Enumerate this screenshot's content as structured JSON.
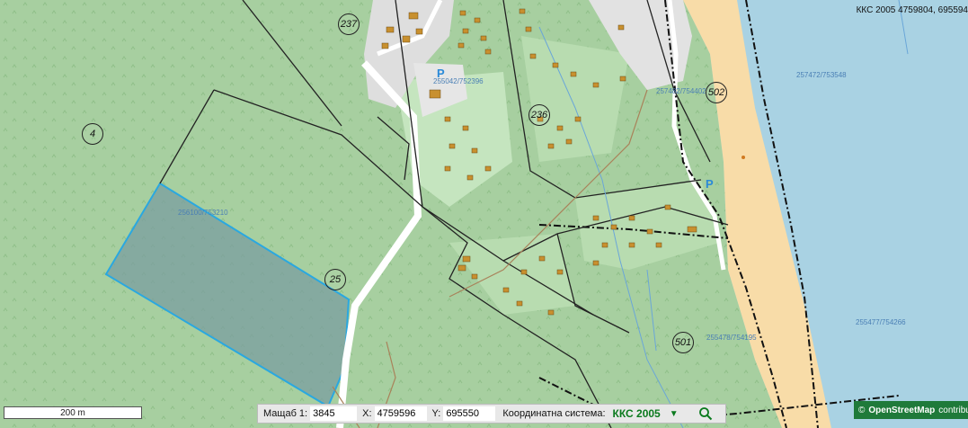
{
  "coord_readout": "ККС 2005 4759804, 695594",
  "parcel_numbers": [
    {
      "name": "parcel-237",
      "label": "237"
    },
    {
      "name": "parcel-4",
      "label": "4"
    },
    {
      "name": "parcel-236",
      "label": "236"
    },
    {
      "name": "parcel-502",
      "label": "502"
    },
    {
      "name": "parcel-25",
      "label": "25"
    },
    {
      "name": "parcel-501",
      "label": "501"
    }
  ],
  "parcel_ids": [
    {
      "name": "parcel-id-255042",
      "label": "255042/752396"
    },
    {
      "name": "parcel-id-402",
      "label": "257482/754402"
    },
    {
      "name": "parcel-id-257472",
      "label": "257472/753548"
    },
    {
      "name": "parcel-id-selected",
      "label": "256100/753210"
    },
    {
      "name": "parcel-id-255477",
      "label": "255477/754266"
    },
    {
      "name": "parcel-id-255478",
      "label": "255478/754195"
    }
  ],
  "parking_label": "P",
  "scale_bar_label": "200 m",
  "status_bar": {
    "scale_label": "Мащаб 1:",
    "scale_value": "3845",
    "x_label": "X:",
    "x_value": "4759596",
    "y_label": "Y:",
    "y_value": "695550",
    "crs_label": "Координатна система:",
    "crs_value": "ККС 2005",
    "crs_arrow": "▼"
  },
  "attribution": {
    "copyright": "©",
    "brand": "OpenStreetMap",
    "suffix": "contributors"
  },
  "colors": {
    "forest": "#a7cfa0",
    "light_green": "#c5e5bf",
    "sea": "#a9d2e3",
    "beach": "#f8dca8",
    "building": "#c8902f",
    "selection_fill": "#7a9ea0",
    "selection_stroke": "#2aa8e0",
    "status_green": "#0b7a1e"
  }
}
